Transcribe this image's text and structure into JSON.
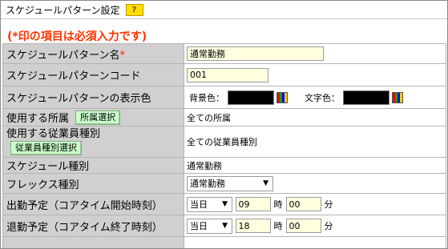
{
  "header": {
    "title": "スケジュールパターン設定",
    "help_label": "?"
  },
  "required_note": "(*印の項目は必須入力です)",
  "rows": {
    "name": {
      "label": "スケジュールパターン名",
      "required_mark": "*",
      "value": "通常勤務"
    },
    "code": {
      "label": "スケジュールパターンコード",
      "value": "001"
    },
    "color": {
      "label": "スケジュールパターンの表示色",
      "bg_label": "背景色：",
      "bg_color": "#000000",
      "text_label": "文字色：",
      "text_color": "#000000"
    },
    "dept": {
      "label": "使用する所属",
      "button": "所属選択",
      "value": "全ての所属"
    },
    "emptype": {
      "label": "使用する従業員種別",
      "button": "従業員種別選択",
      "value": "全ての従業員種別"
    },
    "schedule_type": {
      "label": "スケジュール種別",
      "value": "通常勤務"
    },
    "flex": {
      "label": "フレックス種別",
      "selected": "通常勤務"
    },
    "start": {
      "label": "出勤予定（コアタイム開始時刻）",
      "day": "当日",
      "hour": "09",
      "hour_unit": "時",
      "minute": "00",
      "minute_unit": "分"
    },
    "end": {
      "label": "退勤予定（コアタイム終了時刻）",
      "day": "当日",
      "hour": "18",
      "hour_unit": "時",
      "minute": "00",
      "minute_unit": "分"
    }
  }
}
